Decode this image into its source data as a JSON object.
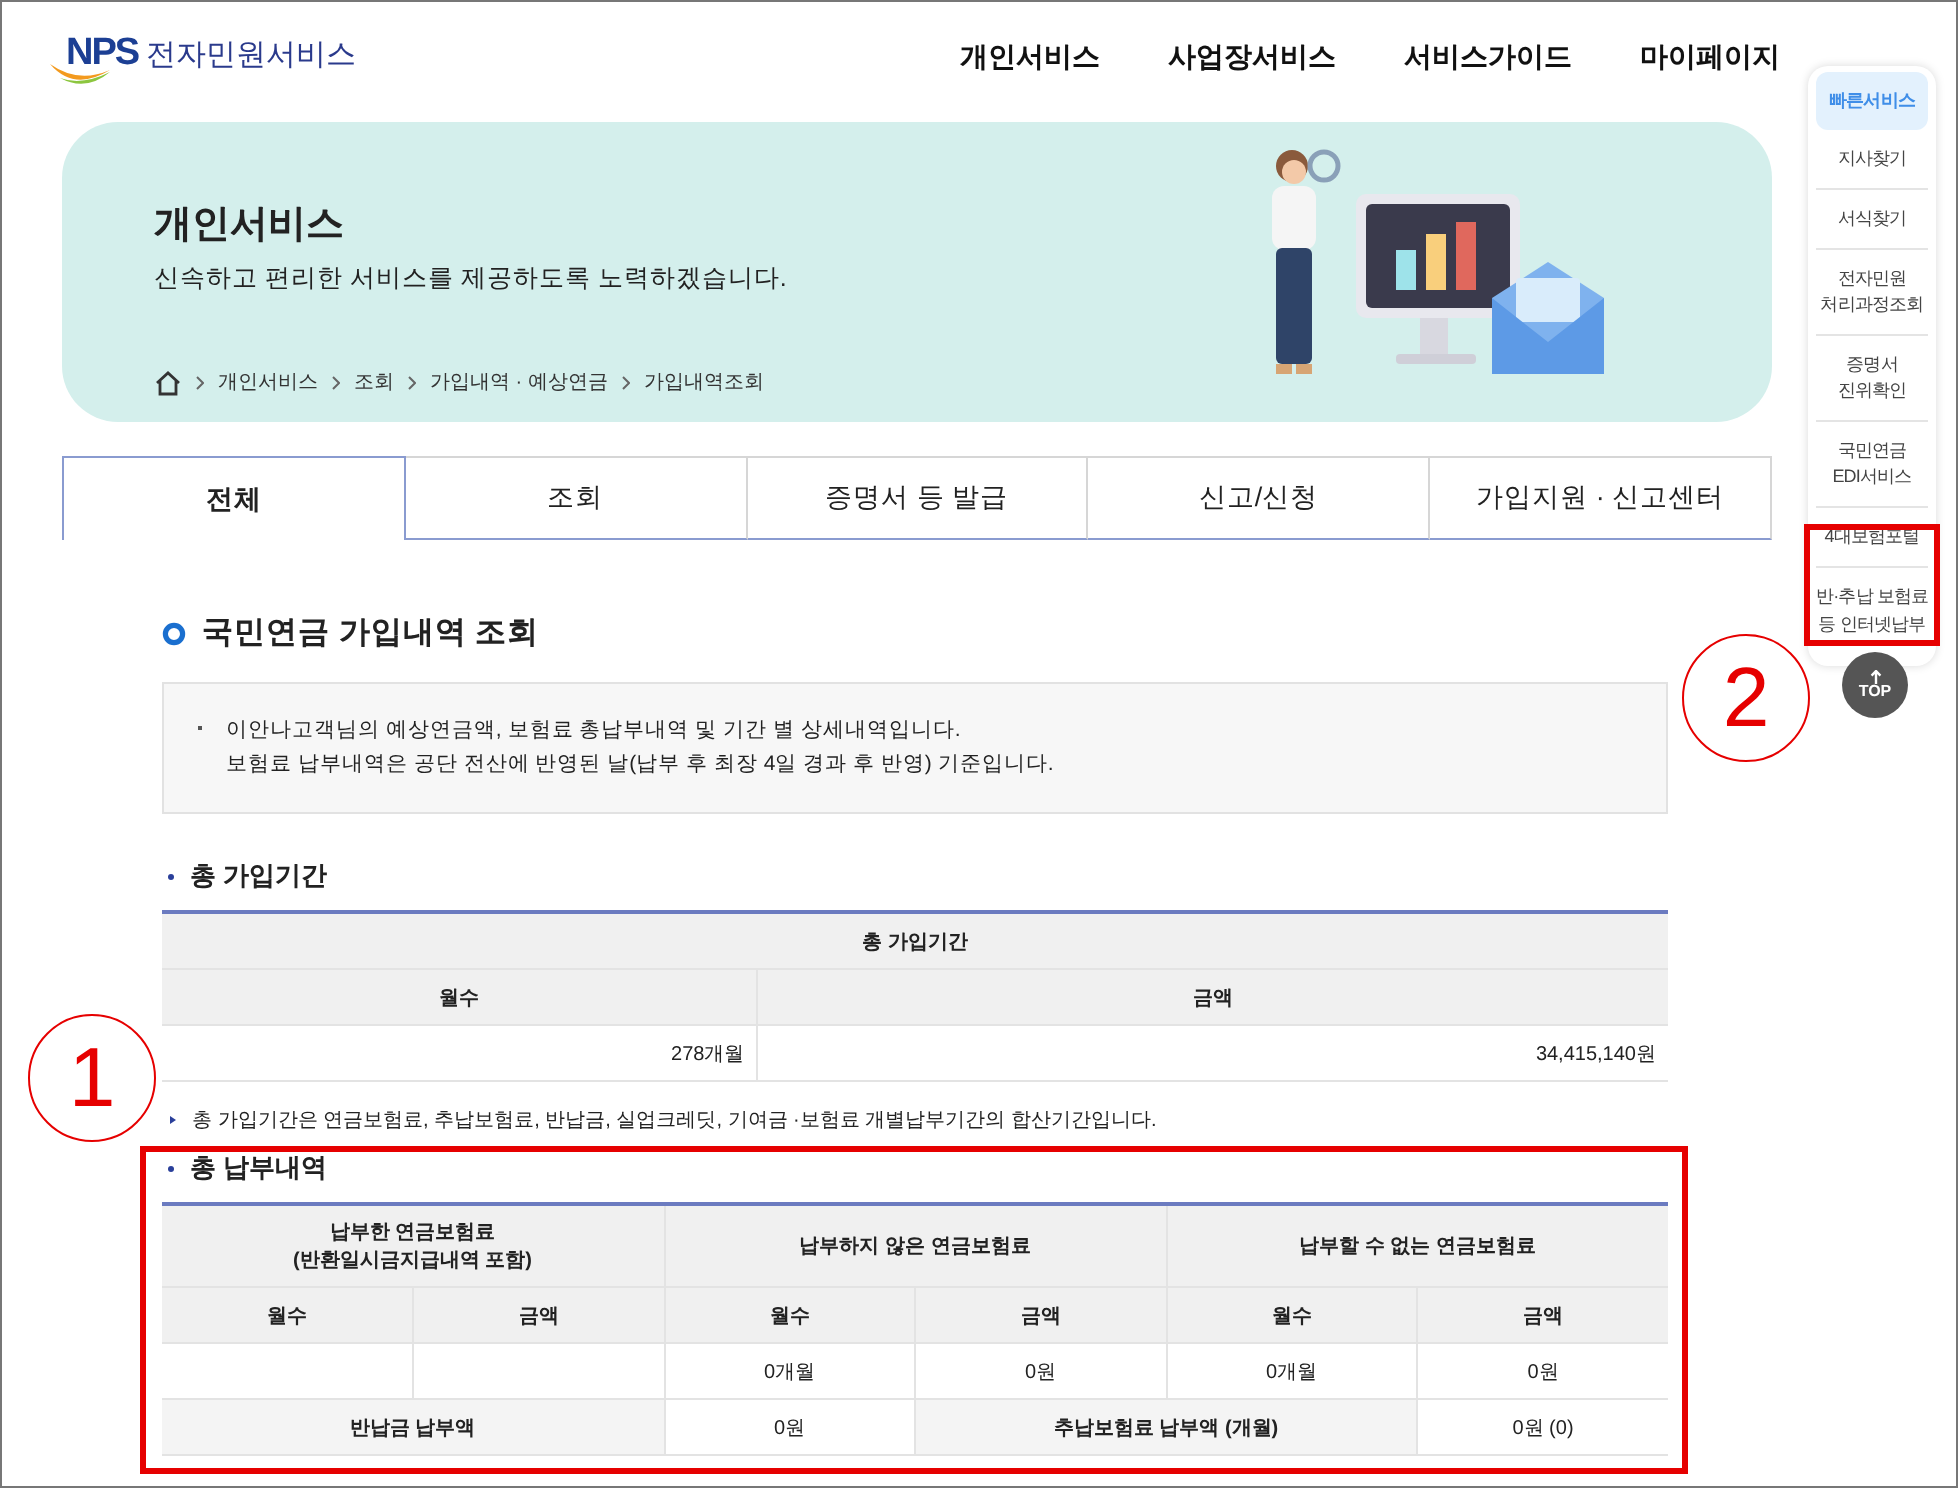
{
  "header": {
    "logo_mark": "NPS",
    "service_name": "전자민원서비스",
    "nav": [
      "개인서비스",
      "사업장서비스",
      "서비스가이드",
      "마이페이지"
    ]
  },
  "banner": {
    "title": "개인서비스",
    "subtitle": "신속하고 편리한 서비스를 제공하도록 노력하겠습니다.",
    "breadcrumb": [
      "개인서비스",
      "조회",
      "가입내역 · 예상연금",
      "가입내역조회"
    ]
  },
  "tabs": [
    {
      "label": "전체",
      "selected": true
    },
    {
      "label": "조회",
      "selected": false
    },
    {
      "label": "증명서 등 발급",
      "selected": false
    },
    {
      "label": "신고/신청",
      "selected": false
    },
    {
      "label": "가입지원 · 신고센터",
      "selected": false
    }
  ],
  "quick_menu": {
    "items": [
      {
        "lines": [
          "빠른서비스"
        ],
        "selected": true
      },
      {
        "lines": [
          "지사찾기"
        ],
        "selected": false
      },
      {
        "lines": [
          "서식찾기"
        ],
        "selected": false
      },
      {
        "lines": [
          "전자민원",
          "처리과정조회"
        ],
        "selected": false
      },
      {
        "lines": [
          "증명서",
          "진위확인"
        ],
        "selected": false
      },
      {
        "lines": [
          "국민연금",
          "EDI서비스"
        ],
        "selected": false
      },
      {
        "lines": [
          "4대보험포털"
        ],
        "selected": false
      },
      {
        "lines": [
          "반·추납 보험료",
          "등 인터넷납부"
        ],
        "selected": false
      }
    ],
    "top_button": "TOP"
  },
  "section": {
    "title": "국민연금 가입내역 조회",
    "notices": [
      "이안나고객님의 예상연금액, 보험료 총납부내역 및 기간 별 상세내역입니다.",
      "보험료 납부내역은 공단 전산에 반영된 날(납부 후 최장 4일 경과 후 반영) 기준입니다."
    ]
  },
  "total_period": {
    "title": "총 가입기간",
    "caption": "총 가입기간",
    "columns": [
      "월수",
      "금액"
    ],
    "values": [
      "278개월",
      "34,415,140원"
    ],
    "note": "총 가입기간은 연금보험료, 추납보험료, 반납금, 실업크레딧, 기여금 ·보험료 개별납부기간의 합산기간입니다."
  },
  "total_payment": {
    "title": "총 납부내역",
    "groups": [
      {
        "title": "납부한 연금보험료",
        "subtitle": "(반환일시금지급내역 포함)",
        "columns": [
          "월수",
          "금액"
        ]
      },
      {
        "title": "납부하지 않은 연금보험료",
        "columns": [
          "월수",
          "금액"
        ],
        "values": [
          "0개월",
          "0원"
        ]
      },
      {
        "title": "납부할 수 없는 연금보험료",
        "columns": [
          "월수",
          "금액"
        ],
        "values": [
          "0개월",
          "0원"
        ]
      }
    ],
    "summary": [
      {
        "label": "반납금 납부액",
        "value": "0원"
      },
      {
        "label": "추납보험료 납부액 (개월)",
        "value": "0원 (0)"
      }
    ]
  },
  "annotations": [
    {
      "label": "1"
    },
    {
      "label": "2"
    }
  ]
}
